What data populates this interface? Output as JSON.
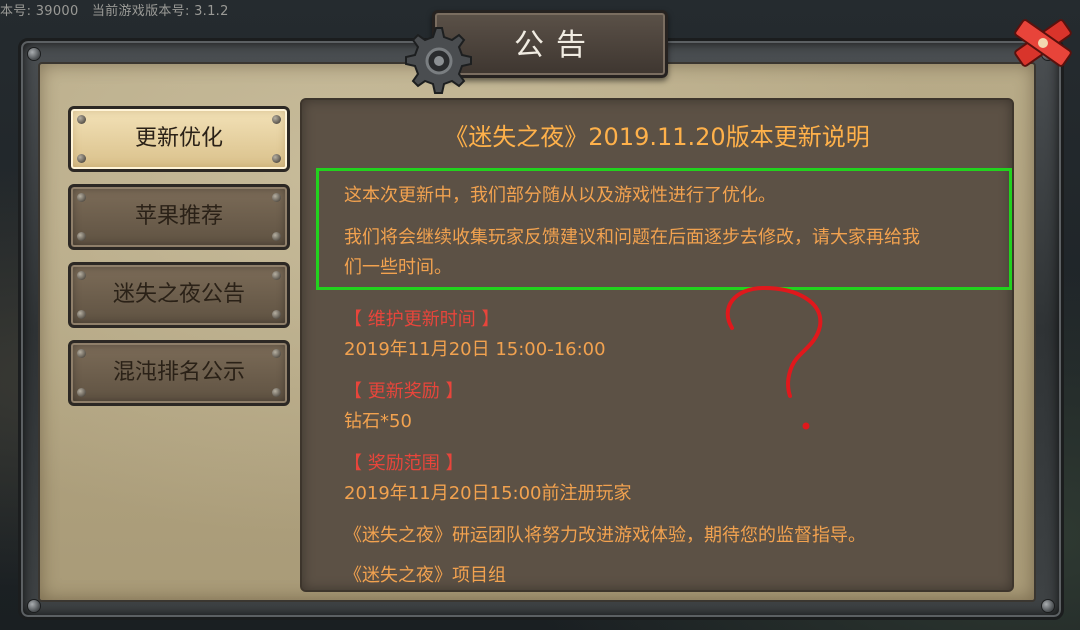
{
  "header": {
    "version_text": "本号: 39000   当前游戏版本号: 3.1.2"
  },
  "dialog": {
    "title": "公告"
  },
  "tabs": [
    {
      "label": "更新优化",
      "active": true
    },
    {
      "label": "苹果推荐",
      "active": false
    },
    {
      "label": "迷失之夜公告",
      "active": false
    },
    {
      "label": "混沌排名公示",
      "active": false
    }
  ],
  "notice": {
    "title": "《迷失之夜》2019.11.20版本更新说明",
    "intro_line1": "这本次更新中，我们部分随从以及游戏性进行了优化。",
    "intro_line2a": "我们将会继续收集玩家反馈建议和问题在后面逐步去修改，请大家再给我",
    "intro_line2b": "们一些时间。",
    "maint_header": "【 维护更新时间 】",
    "maint_value": "2019年11月20日 15:00-16:00",
    "reward_header": "【 更新奖励 】",
    "reward_value": "钻石*50",
    "scope_header": "【 奖励范围 】",
    "scope_value": "2019年11月20日15:00前注册玩家",
    "closing": "《迷失之夜》研运团队将努力改进游戏体验，期待您的监督指导。",
    "signature": "《迷失之夜》项目组"
  },
  "icons": {
    "gear": "gear-icon",
    "close": "close-icon"
  },
  "colors": {
    "title_orange": "#ffb14a",
    "body_orange": "#f2a24f",
    "section_red": "#e8453b",
    "annotation_green": "#22d21e",
    "annotation_red": "#e0181c"
  }
}
